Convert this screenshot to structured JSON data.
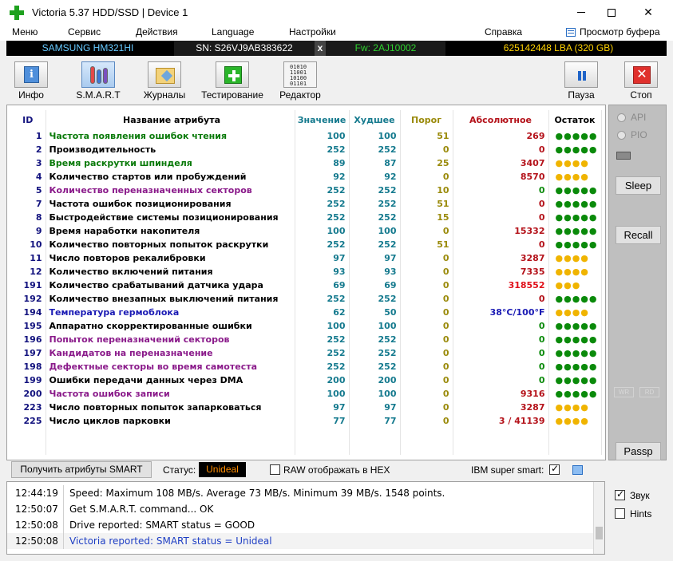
{
  "window": {
    "title": "Victoria 5.37 HDD/SSD | Device 1",
    "minimize": "—",
    "maximize": "☐",
    "close": "✕"
  },
  "menu": {
    "items": [
      "Меню",
      "Сервис",
      "Действия",
      "Language",
      "Настройки",
      "Справка"
    ],
    "buffer_view": "Просмотр буфера"
  },
  "device": {
    "model": "SAMSUNG HM321HI",
    "serial": "SN: S26VJ9AB383622",
    "x_button": "x",
    "firmware": "Fw: 2AJ10002",
    "lba": "625142448 LBA (320 GB)"
  },
  "toolbar": {
    "info": "Инфо",
    "smart": "S.M.A.R.T",
    "journals": "Журналы",
    "testing": "Тестирование",
    "editor": "Редактор",
    "pause": "Пауза",
    "stop": "Стоп",
    "editor_icon_text": [
      "01010",
      "11001",
      "10100",
      "01101"
    ]
  },
  "smart_table": {
    "headers": {
      "id": "ID",
      "name": "Название атрибута",
      "value": "Значение",
      "worst": "Худшее",
      "threshold": "Порог",
      "raw": "Абсолютное",
      "remaining": "Остаток"
    },
    "rows": [
      {
        "id": "1",
        "name": "Частота появления ошибок чтения",
        "value": "100",
        "worst": "100",
        "threshold": "51",
        "raw": "269",
        "remaining": "●●●●●",
        "name_color": "#0a7a0a",
        "raw_color": "#b4121a",
        "dots": "green"
      },
      {
        "id": "2",
        "name": "Производительность",
        "value": "252",
        "worst": "252",
        "threshold": "0",
        "raw": "0",
        "remaining": "●●●●●",
        "name_color": "#000000",
        "raw_color": "#b4121a",
        "dots": "green"
      },
      {
        "id": "3",
        "name": "Время раскрутки шпинделя",
        "value": "89",
        "worst": "87",
        "threshold": "25",
        "raw": "3407",
        "remaining": "●●●●",
        "name_color": "#0a7a0a",
        "raw_color": "#b4121a",
        "dots": "yellow"
      },
      {
        "id": "4",
        "name": "Количество стартов или пробуждений",
        "value": "92",
        "worst": "92",
        "threshold": "0",
        "raw": "8570",
        "remaining": "●●●●",
        "name_color": "#000000",
        "raw_color": "#b4121a",
        "dots": "yellow"
      },
      {
        "id": "5",
        "name": "Количество переназначенных секторов",
        "value": "252",
        "worst": "252",
        "threshold": "10",
        "raw": "0",
        "remaining": "●●●●●",
        "name_color": "#8a1a8a",
        "raw_color": "#0a8a0a",
        "dots": "green"
      },
      {
        "id": "7",
        "name": "Частота ошибок позиционирования",
        "value": "252",
        "worst": "252",
        "threshold": "51",
        "raw": "0",
        "remaining": "●●●●●",
        "name_color": "#000000",
        "raw_color": "#b4121a",
        "dots": "green"
      },
      {
        "id": "8",
        "name": "Быстродействие системы позиционирования",
        "value": "252",
        "worst": "252",
        "threshold": "15",
        "raw": "0",
        "remaining": "●●●●●",
        "name_color": "#000000",
        "raw_color": "#b4121a",
        "dots": "green"
      },
      {
        "id": "9",
        "name": "Время наработки накопителя",
        "value": "100",
        "worst": "100",
        "threshold": "0",
        "raw": "15332",
        "remaining": "●●●●●",
        "name_color": "#000000",
        "raw_color": "#b4121a",
        "dots": "green"
      },
      {
        "id": "10",
        "name": "Количество повторных попыток раскрутки",
        "value": "252",
        "worst": "252",
        "threshold": "51",
        "raw": "0",
        "remaining": "●●●●●",
        "name_color": "#000000",
        "raw_color": "#b4121a",
        "dots": "green"
      },
      {
        "id": "11",
        "name": "Число повторов рекалибровки",
        "value": "97",
        "worst": "97",
        "threshold": "0",
        "raw": "3287",
        "remaining": "●●●●",
        "name_color": "#000000",
        "raw_color": "#b4121a",
        "dots": "yellow"
      },
      {
        "id": "12",
        "name": "Количество включений питания",
        "value": "93",
        "worst": "93",
        "threshold": "0",
        "raw": "7335",
        "remaining": "●●●●",
        "name_color": "#000000",
        "raw_color": "#b4121a",
        "dots": "yellow"
      },
      {
        "id": "191",
        "name": "Количество срабатываний датчика удара",
        "value": "69",
        "worst": "69",
        "threshold": "0",
        "raw": "318552",
        "remaining": "●●●",
        "name_color": "#000000",
        "raw_color": "#e0101a",
        "dots": "yellow"
      },
      {
        "id": "192",
        "name": "Количество внезапных выключений питания",
        "value": "252",
        "worst": "252",
        "threshold": "0",
        "raw": "0",
        "remaining": "●●●●●",
        "name_color": "#000000",
        "raw_color": "#b4121a",
        "dots": "green"
      },
      {
        "id": "194",
        "name": "Температура гермоблока",
        "value": "62",
        "worst": "50",
        "threshold": "0",
        "raw": "38°C/100°F",
        "remaining": "●●●●",
        "name_color": "#1a1ab4",
        "raw_color": "#1a1ab4",
        "dots": "yellow"
      },
      {
        "id": "195",
        "name": "Аппаратно скорректированные ошибки",
        "value": "100",
        "worst": "100",
        "threshold": "0",
        "raw": "0",
        "remaining": "●●●●●",
        "name_color": "#000000",
        "raw_color": "#0a8a0a",
        "dots": "green"
      },
      {
        "id": "196",
        "name": "Попыток переназначений секторов",
        "value": "252",
        "worst": "252",
        "threshold": "0",
        "raw": "0",
        "remaining": "●●●●●",
        "name_color": "#8a1a8a",
        "raw_color": "#0a8a0a",
        "dots": "green"
      },
      {
        "id": "197",
        "name": "Кандидатов на переназначение",
        "value": "252",
        "worst": "252",
        "threshold": "0",
        "raw": "0",
        "remaining": "●●●●●",
        "name_color": "#8a1a8a",
        "raw_color": "#0a8a0a",
        "dots": "green"
      },
      {
        "id": "198",
        "name": "Дефектные секторы во время самотеста",
        "value": "252",
        "worst": "252",
        "threshold": "0",
        "raw": "0",
        "remaining": "●●●●●",
        "name_color": "#8a1a8a",
        "raw_color": "#0a8a0a",
        "dots": "green"
      },
      {
        "id": "199",
        "name": "Ошибки передачи данных через DMA",
        "value": "200",
        "worst": "200",
        "threshold": "0",
        "raw": "0",
        "remaining": "●●●●●",
        "name_color": "#000000",
        "raw_color": "#0a8a0a",
        "dots": "green"
      },
      {
        "id": "200",
        "name": "Частота ошибок записи",
        "value": "100",
        "worst": "100",
        "threshold": "0",
        "raw": "9316",
        "remaining": "●●●●●",
        "name_color": "#8a1a8a",
        "raw_color": "#b4121a",
        "dots": "green"
      },
      {
        "id": "223",
        "name": "Число повторных попыток запарковаться",
        "value": "97",
        "worst": "97",
        "threshold": "0",
        "raw": "3287",
        "remaining": "●●●●",
        "name_color": "#000000",
        "raw_color": "#b4121a",
        "dots": "yellow"
      },
      {
        "id": "225",
        "name": "Число циклов парковки",
        "value": "77",
        "worst": "77",
        "threshold": "0",
        "raw": "3 / 41139",
        "remaining": "●●●●",
        "name_color": "#000000",
        "raw_color": "#b4121a",
        "dots": "yellow"
      }
    ]
  },
  "side": {
    "api": "API",
    "pio": "PIO",
    "sleep": "Sleep",
    "recall": "Recall",
    "wr": "WR",
    "rd": "RD",
    "passp": "Passp"
  },
  "status": {
    "get_button": "Получить атрибуты SMART",
    "label": "Статус:",
    "value": "Unideal",
    "raw_hex": "RAW отображать в HEX",
    "raw_hex_checked": false,
    "ibm": "IBM super smart:",
    "ibm_checked": true
  },
  "log": [
    {
      "time": "12:44:19",
      "message": "Speed: Maximum 108 MB/s. Average 73 MB/s. Minimum 39 MB/s. 1548 points."
    },
    {
      "time": "12:50:07",
      "message": "Get S.M.A.R.T. command... OK"
    },
    {
      "time": "12:50:08",
      "message": "Drive reported: SMART status = GOOD"
    },
    {
      "time": "12:50:08",
      "message": "Victoria reported: SMART status = Unideal"
    }
  ],
  "options": {
    "sound": "Звук",
    "sound_checked": true,
    "hints": "Hints",
    "hints_checked": false
  }
}
